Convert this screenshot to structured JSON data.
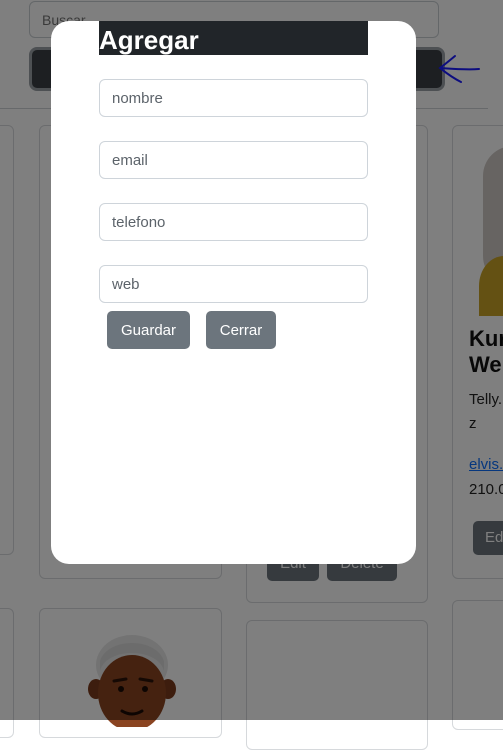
{
  "search": {
    "placeholder": "Buscar"
  },
  "modal": {
    "title": "Agregar",
    "fields": [
      {
        "placeholder": "nombre",
        "value": ""
      },
      {
        "placeholder": "email",
        "value": ""
      },
      {
        "placeholder": "telefono",
        "value": ""
      },
      {
        "placeholder": "web",
        "value": ""
      }
    ],
    "save_label": "Guardar",
    "close_label": "Cerrar"
  },
  "cards": {
    "right_card": {
      "name_line1": "Kur",
      "name_line2": "We",
      "username": "Telly.",
      "street_fragment": "z",
      "email_fragment": "elvis.",
      "phone_fragment": "210.0",
      "edit_fragment": "Ed"
    },
    "center_card": {
      "edit_label": "Edit",
      "delete_label": "Delete"
    }
  },
  "colors": {
    "modal_title_bg": "#212529",
    "button_bg": "#6c757d",
    "annotation_arrow": "#1a1aff"
  },
  "icons": {
    "annotation": "hand-drawn-arrow-icon"
  }
}
